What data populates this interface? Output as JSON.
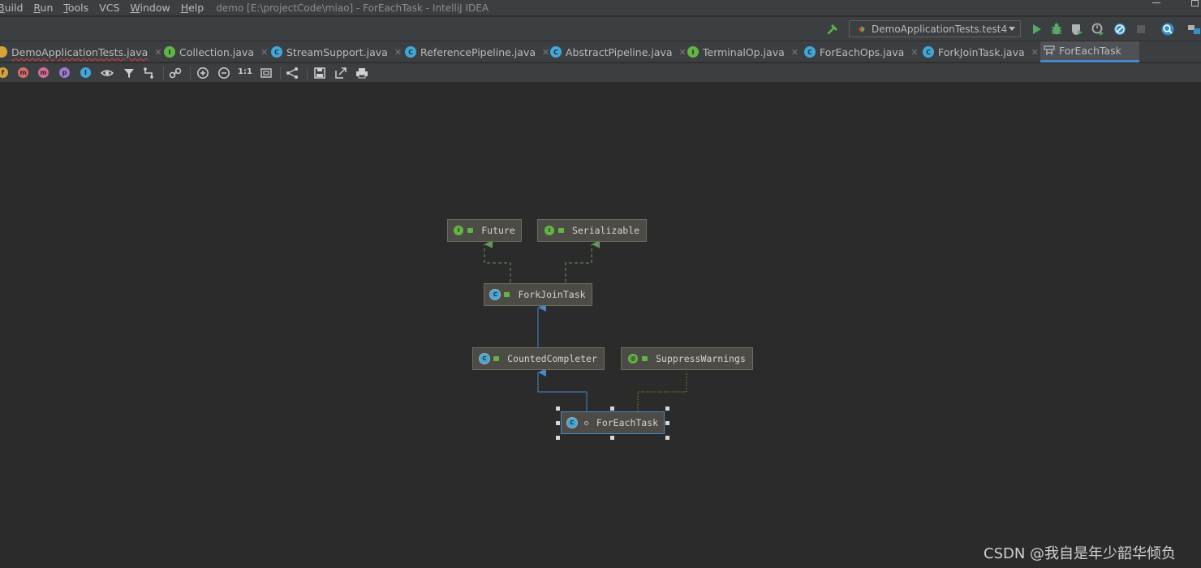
{
  "window": {
    "title": "demo [E:\\projectCode\\miao] - ForEachTask - IntelliJ IDEA"
  },
  "menu": {
    "items": [
      {
        "label": "Build",
        "mnemonic": "B",
        "rest": "uild"
      },
      {
        "label": "Run",
        "mnemonic": "R",
        "rest": "un"
      },
      {
        "label": "Tools",
        "mnemonic": "T",
        "rest": "ools"
      },
      {
        "label": "VCS",
        "mnemonic": "",
        "rest": "VCS"
      },
      {
        "label": "Window",
        "mnemonic": "W",
        "rest": "indow"
      },
      {
        "label": "Help",
        "mnemonic": "H",
        "rest": "elp"
      }
    ]
  },
  "run_config": {
    "label": "DemoApplicationTests.test4"
  },
  "tabs": [
    {
      "label": "DemoApplicationTests.java",
      "kind": "class",
      "error": true,
      "active": false
    },
    {
      "label": "Collection.java",
      "kind": "interface",
      "error": false,
      "active": false
    },
    {
      "label": "StreamSupport.java",
      "kind": "class",
      "error": false,
      "active": false
    },
    {
      "label": "ReferencePipeline.java",
      "kind": "class",
      "error": false,
      "active": false
    },
    {
      "label": "AbstractPipeline.java",
      "kind": "class",
      "error": false,
      "active": false
    },
    {
      "label": "TerminalOp.java",
      "kind": "interface",
      "error": false,
      "active": false
    },
    {
      "label": "ForEachOps.java",
      "kind": "class",
      "error": false,
      "active": false
    },
    {
      "label": "ForkJoinTask.java",
      "kind": "class",
      "error": false,
      "active": false
    },
    {
      "label": "ForEachTask",
      "kind": "diagram",
      "error": false,
      "active": true
    }
  ],
  "diagram_toolbar": {
    "actual_size_label": "1:1",
    "letters": [
      "f",
      "m",
      "m",
      "p",
      "I"
    ]
  },
  "diagram": {
    "nodes": [
      {
        "id": "future",
        "label": "Future",
        "kind": "interface",
        "badge": "I"
      },
      {
        "id": "serializable",
        "label": "Serializable",
        "kind": "interface",
        "badge": "I"
      },
      {
        "id": "forkjointask",
        "label": "ForkJoinTask",
        "kind": "class",
        "badge": "C"
      },
      {
        "id": "countedcompleter",
        "label": "CountedCompleter",
        "kind": "class",
        "badge": "C"
      },
      {
        "id": "suppresswarnings",
        "label": "SuppressWarnings",
        "kind": "annotation",
        "badge": "@"
      },
      {
        "id": "foreachtask",
        "label": "ForEachTask",
        "kind": "class",
        "badge": "C",
        "selected": true
      }
    ],
    "edges": [
      {
        "from": "forkjointask",
        "to": "future",
        "type": "implements"
      },
      {
        "from": "forkjointask",
        "to": "serializable",
        "type": "implements"
      },
      {
        "from": "countedcompleter",
        "to": "forkjointask",
        "type": "extends"
      },
      {
        "from": "foreachtask",
        "to": "countedcompleter",
        "type": "extends"
      },
      {
        "from": "foreachtask",
        "to": "suppresswarnings",
        "type": "annotated"
      }
    ]
  },
  "colors": {
    "implements": "#629755",
    "extends": "#4a88c7",
    "annotated": "#8a8a2e"
  },
  "watermark": "CSDN @我自是年少韶华倾负"
}
